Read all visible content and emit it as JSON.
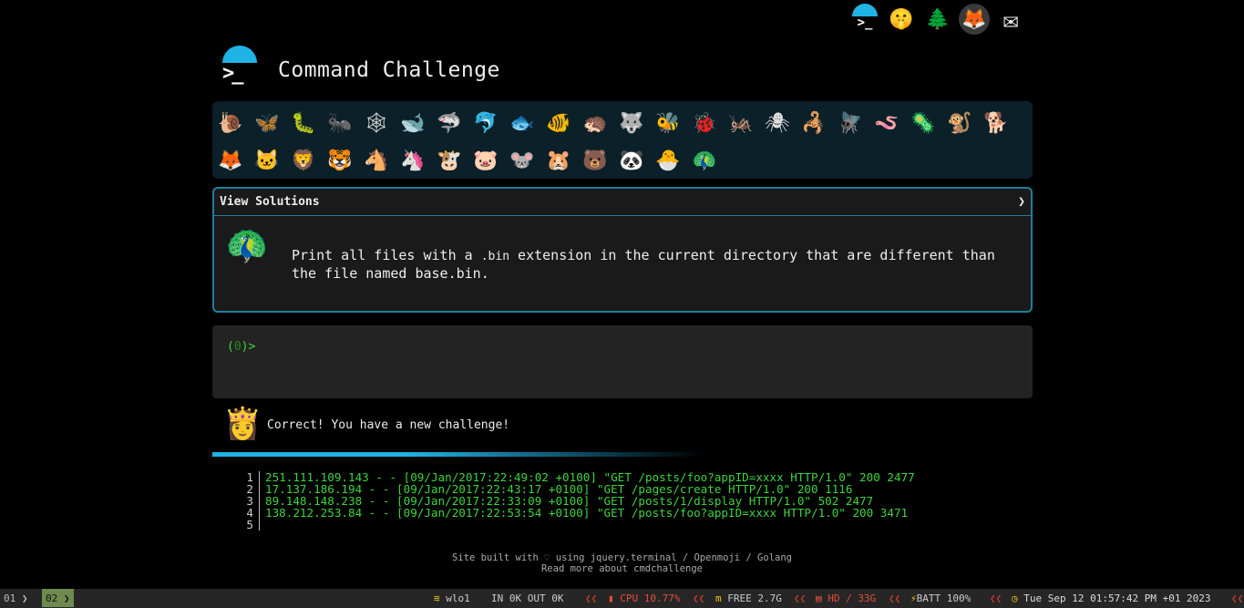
{
  "top_icons": [
    {
      "name": "terminal-icon",
      "glyph": ">_"
    },
    {
      "name": "shushing-face-icon",
      "glyph": "🤫"
    },
    {
      "name": "evergreen-tree-icon",
      "glyph": "🌲"
    },
    {
      "name": "gitlab-icon",
      "glyph": "🦊"
    },
    {
      "name": "envelope-icon",
      "glyph": "✉"
    }
  ],
  "header": {
    "title": "Command Challenge",
    "logo_glyph": ">_"
  },
  "animals": {
    "row1": [
      "🐌",
      "🦋",
      "🐛",
      "🐜",
      "🕸",
      "🐋",
      "🦈",
      "🐬",
      "🐟",
      "🐠",
      "🦔",
      "🐺",
      "🐝",
      "🐞",
      "🦗",
      "🕷",
      "🦂",
      "🪰",
      "🪱",
      "🦠",
      "🐒",
      "🐕"
    ],
    "row2": [
      "🦊",
      "🐱",
      "🦁",
      "🐯",
      "🐴",
      "🦄",
      "🐮",
      "🐷",
      "🐭",
      "🐹",
      "🐻",
      "🐼",
      "🐣",
      "🦚"
    ]
  },
  "panel": {
    "header_label": "View Solutions",
    "toggle_glyph": "❯",
    "icon_glyph": "🦚",
    "text_before": "Print all files with a ",
    "code": ".bin",
    "text_after": " extension in the current directory that are different than the file named base.bin."
  },
  "terminal": {
    "open": "(",
    "count": "0",
    "close": ")>"
  },
  "result": {
    "mascot_glyph": "👸",
    "message": "Correct! You have a new challenge!"
  },
  "listing": [
    {
      "no": "1",
      "text": "251.111.109.143 - - [09/Jan/2017:22:49:02 +0100] \"GET /posts/foo?appID=xxxx HTTP/1.0\" 200 2477"
    },
    {
      "no": "2",
      "text": "17.137.186.194 - - [09/Jan/2017:22:43:17 +0100] \"GET /pages/create HTTP/1.0\" 200 1116"
    },
    {
      "no": "3",
      "text": "89.148.148.238 - - [09/Jan/2017:22:33:09 +0100] \"GET /posts/1/display HTTP/1.0\" 502 2477"
    },
    {
      "no": "4",
      "text": "138.212.253.84 - - [09/Jan/2017:22:53:54 +0100] \"GET /posts/foo?appID=xxxx HTTP/1.0\" 200 3471"
    },
    {
      "no": "5",
      "text": ""
    }
  ],
  "footer": {
    "line1_before": "Site built with ",
    "heart": "♡",
    "line1_after": " using jquery.terminal / Openmoji / Golang",
    "line2": "Read more about cmdchallenge"
  },
  "statusbar": {
    "ws1": "01",
    "ws2": "02",
    "net": "wlo1",
    "traffic": "IN 0K OUT 0K",
    "cpu": "CPU 10.77%",
    "mem": "FREE 2.7G",
    "disk": "HD / 33G",
    "batt": "BATT 100%",
    "clock": "Tue Sep 12 01:57:42 PM +01 2023",
    "sep": "❮❮",
    "chevron": "❯"
  },
  "colors": {
    "accent": "#1fb3e6",
    "terminal_green": "#3fd43f",
    "panel_border": "#1f7f9a"
  }
}
